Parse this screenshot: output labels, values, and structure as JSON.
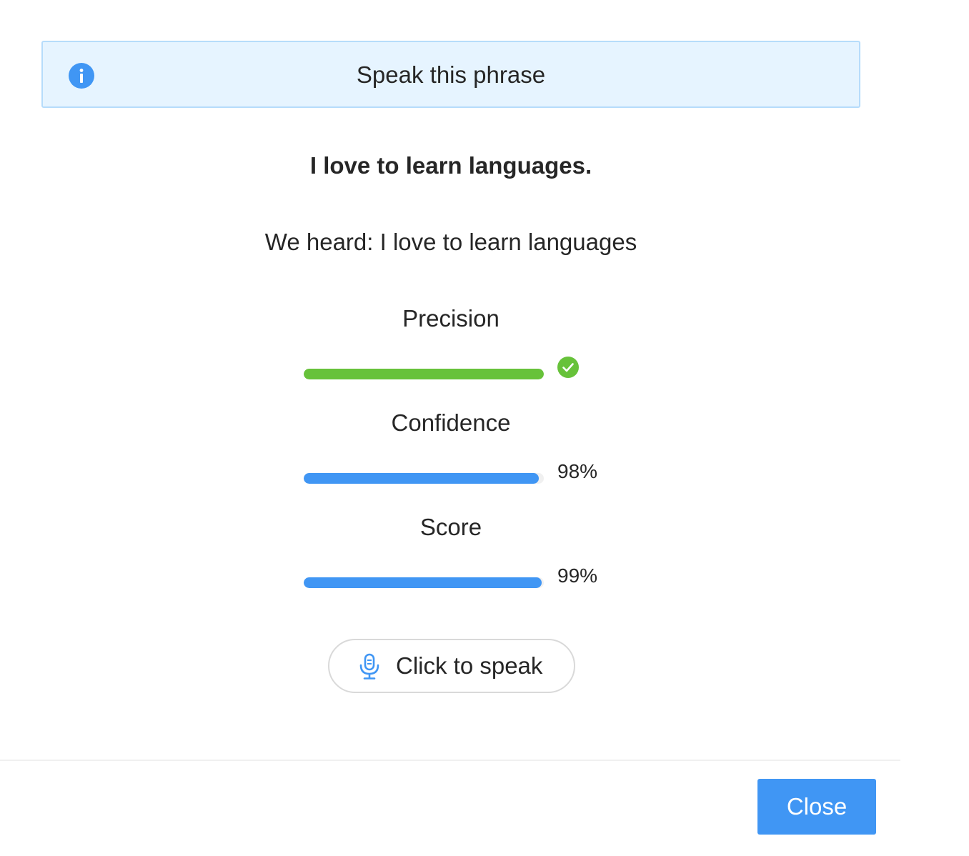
{
  "alert": {
    "icon": "info-icon",
    "text": "Speak this phrase"
  },
  "phrase": "I love to learn languages.",
  "heard": "We heard: I love to learn languages",
  "metrics": [
    {
      "label": "Precision",
      "value": 1.0,
      "status": "check-circle-icon",
      "color": "#67c23a"
    },
    {
      "label": "Confidence",
      "value": 0.98,
      "percent_text": "98%",
      "color": "#4096f4"
    },
    {
      "label": "Score",
      "value": 0.99,
      "percent_text": "99%",
      "color": "#4096f4"
    }
  ],
  "speak_button": {
    "icon": "microphone-icon",
    "label": "Click to speak"
  },
  "close_button": {
    "label": "Close"
  },
  "colors": {
    "accent": "#4096f4",
    "success": "#67c23a",
    "alert_bg": "#e6f4ff",
    "alert_border": "#b6dcfb"
  }
}
